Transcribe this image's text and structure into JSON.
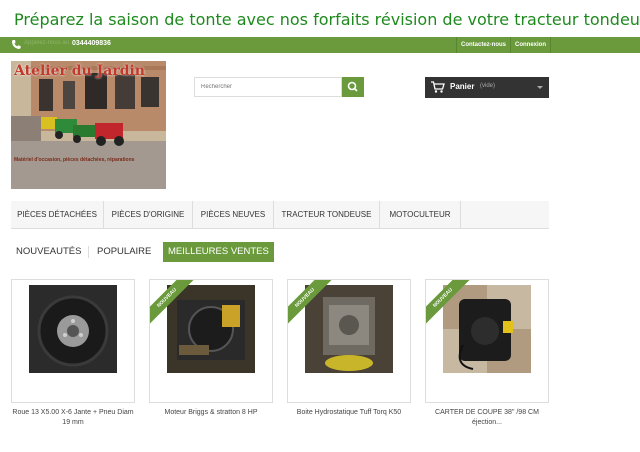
{
  "promo_banner": "Préparez la saison de tonte avec nos forfaits révision de votre tracteur tondeuse !",
  "topbar": {
    "call_us_label": "Appelez-nous au :",
    "phone": "0344409836",
    "contact_link": "Contactez-nous",
    "login_link": "Connexion",
    "phone_icon": "phone-icon"
  },
  "logo": {
    "title": "Atelier du Jardin",
    "tagline": "Matériel d'occasion, pièces détachées, réparations"
  },
  "search": {
    "placeholder": "Rechercher",
    "button_icon": "search-icon"
  },
  "cart": {
    "label": "Panier",
    "status": "(vide)",
    "icon": "cart-icon"
  },
  "nav": {
    "items": [
      "PIÈCES DÉTACHÉES",
      "PIÈCES D'ORIGINE",
      "PIÈCES NEUVES",
      "TRACTEUR TONDEUSE",
      "MOTOCULTEUR"
    ]
  },
  "tabs": {
    "items": [
      "NOUVEAUTÉS",
      "POPULAIRE",
      "MEILLEURES VENTES"
    ],
    "active": "MEILLEURES VENTES"
  },
  "products": {
    "badge": "NOUVEAU",
    "items": [
      {
        "name": "Roue 13 X5.00 X-6 Jante + Pneu Diam 19 mm",
        "new": false
      },
      {
        "name": "Moteur Briggs & stratton 8 HP",
        "new": true
      },
      {
        "name": "Boite Hydrostatique Tuff Torq K50",
        "new": true
      },
      {
        "name": "CARTER DE COUPE 38\" /98 CM éjection...",
        "new": true
      }
    ]
  },
  "colors": {
    "accent": "#6a9a3c",
    "promo_text": "#1e8a1e",
    "cart_bg": "#333333"
  }
}
